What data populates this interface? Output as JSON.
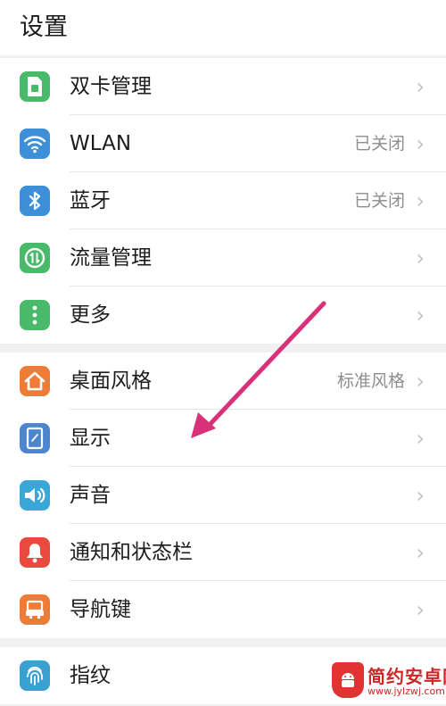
{
  "header": {
    "title": "设置"
  },
  "groups": [
    {
      "items": [
        {
          "label": "双卡管理",
          "value": "",
          "icon": "sim-card-icon",
          "color": "#49b96a"
        },
        {
          "label": "WLAN",
          "value": "已关闭",
          "icon": "wifi-icon",
          "color": "#3e8fd9"
        },
        {
          "label": "蓝牙",
          "value": "已关闭",
          "icon": "bluetooth-icon",
          "color": "#3e8fd9"
        },
        {
          "label": "流量管理",
          "value": "",
          "icon": "data-usage-icon",
          "color": "#49b96a"
        },
        {
          "label": "更多",
          "value": "",
          "icon": "more-icon",
          "color": "#49b96a"
        }
      ]
    },
    {
      "items": [
        {
          "label": "桌面风格",
          "value": "标准风格",
          "icon": "home-icon",
          "color": "#ee7b36"
        },
        {
          "label": "显示",
          "value": "",
          "icon": "display-icon",
          "color": "#4b86cf"
        },
        {
          "label": "声音",
          "value": "",
          "icon": "sound-icon",
          "color": "#39a8d8"
        },
        {
          "label": "通知和状态栏",
          "value": "",
          "icon": "notification-icon",
          "color": "#e84a3e"
        },
        {
          "label": "导航键",
          "value": "",
          "icon": "navigation-key-icon",
          "color": "#ee7b36"
        }
      ]
    },
    {
      "items": [
        {
          "label": "指纹",
          "value": "",
          "icon": "fingerprint-icon",
          "color": "#3aa0cf"
        }
      ]
    }
  ],
  "chevron": "›",
  "annotation": {
    "color": "#d8317a"
  },
  "watermark": {
    "name": "简约安卓网",
    "url": "www.jylzwj.com"
  }
}
